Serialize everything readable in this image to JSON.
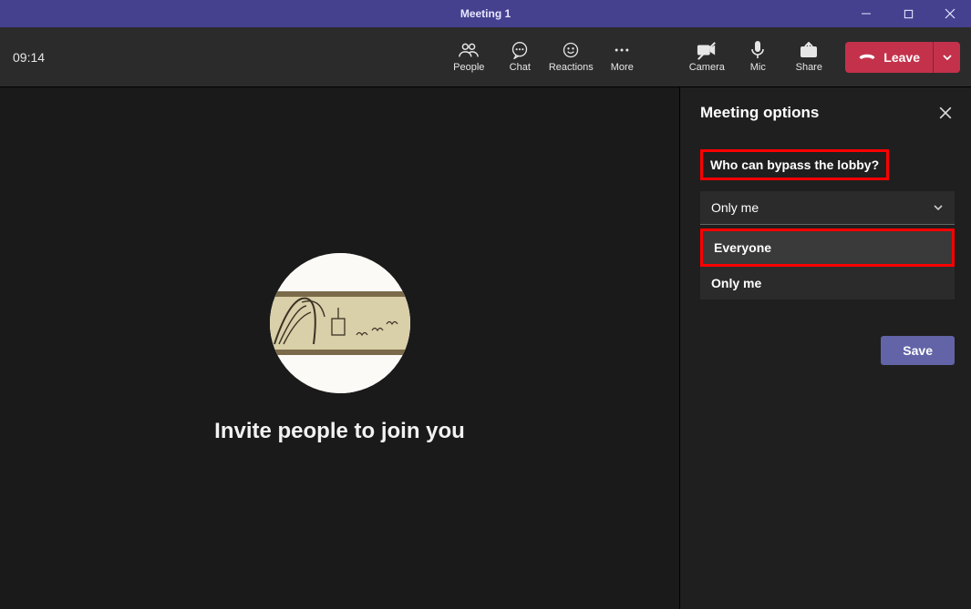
{
  "titlebar": {
    "title": "Meeting 1"
  },
  "toolbar": {
    "timer": "09:14",
    "people": "People",
    "chat": "Chat",
    "reactions": "Reactions",
    "more": "More",
    "camera": "Camera",
    "mic": "Mic",
    "share": "Share",
    "leave": "Leave"
  },
  "main": {
    "invite": "Invite people to join you"
  },
  "panel": {
    "title": "Meeting options",
    "q_bypass": "Who can bypass the lobby?",
    "selected": "Only me",
    "options": {
      "everyone": "Everyone",
      "only_me": "Only me"
    },
    "save": "Save"
  }
}
